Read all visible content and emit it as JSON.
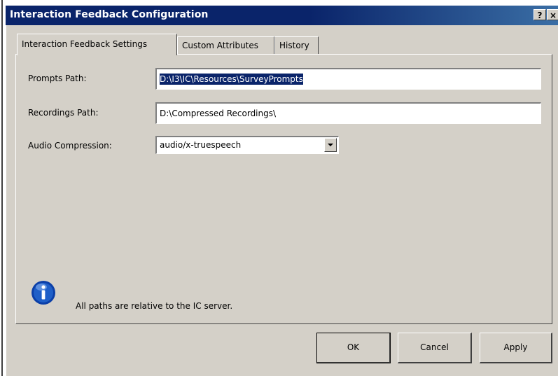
{
  "window": {
    "title": "Interaction Feedback Configuration",
    "help_label": "?",
    "close_label": "×"
  },
  "tabs": [
    {
      "label": "Interaction Feedback Settings",
      "active": true
    },
    {
      "label": "Custom Attributes",
      "active": false
    },
    {
      "label": "History",
      "active": false
    }
  ],
  "form": {
    "prompts_path": {
      "label": "Prompts Path:",
      "value": "D:\\I3\\IC\\Resources\\SurveyPrompts"
    },
    "recordings_path": {
      "label": "Recordings Path:",
      "value": "D:\\Compressed Recordings\\"
    },
    "audio_compression": {
      "label": "Audio Compression:",
      "value": "audio/x-truespeech"
    }
  },
  "info": {
    "icon": "info-icon",
    "text": "All paths are relative to the IC server."
  },
  "buttons": {
    "ok": "OK",
    "cancel": "Cancel",
    "apply": "Apply"
  },
  "colors": {
    "titlebar": "#0a246a",
    "selection": "#0a246a",
    "dialog_bg": "#d4d0c8",
    "info_icon": "#1f5fc8"
  }
}
